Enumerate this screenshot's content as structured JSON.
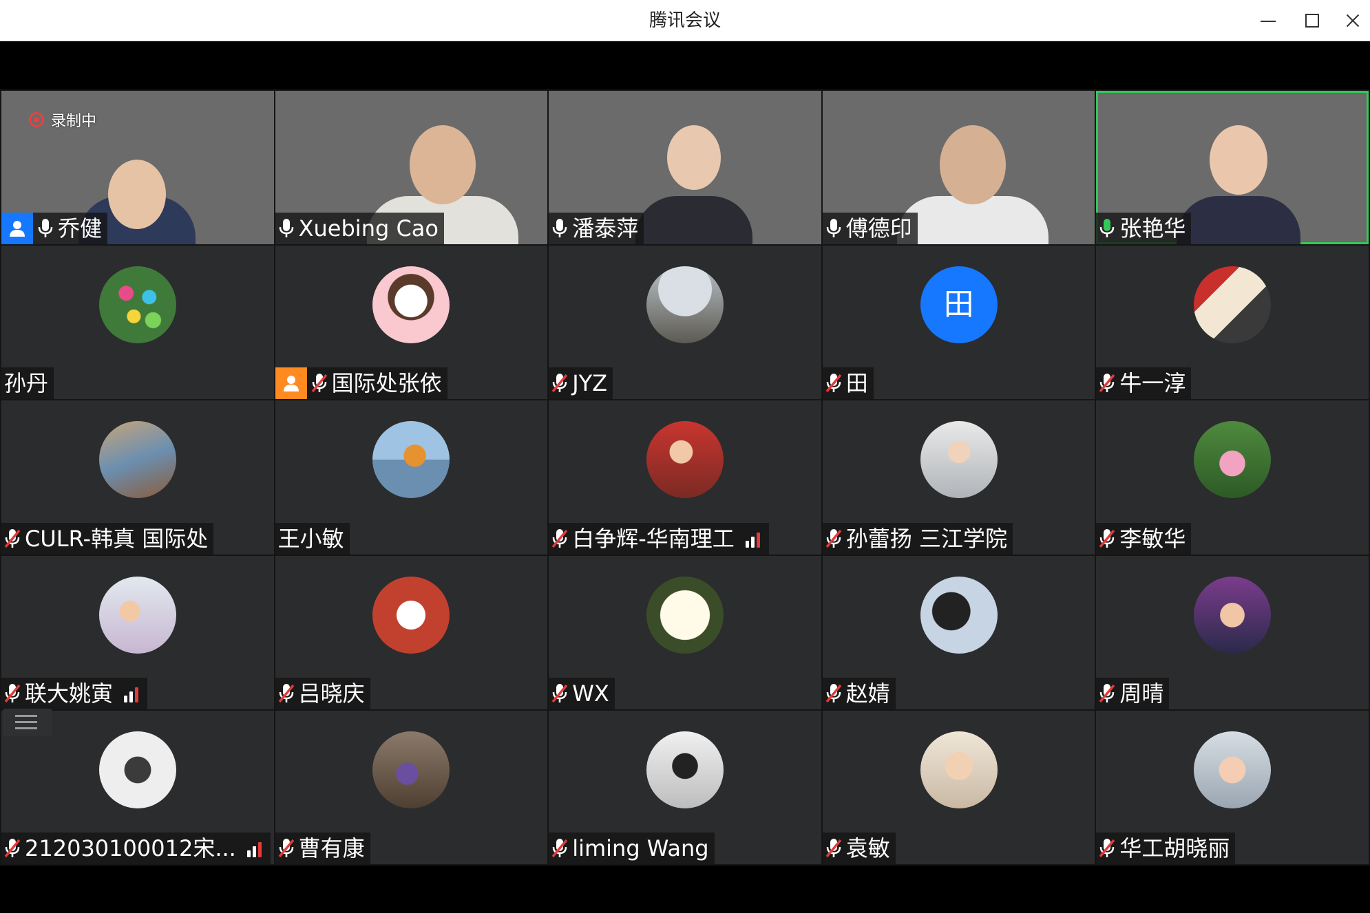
{
  "window": {
    "title": "腾讯会议",
    "controls": {
      "minimize_icon": "minimize-icon",
      "maximize_icon": "maximize-icon",
      "close_icon": "close-icon"
    }
  },
  "recording": {
    "label": "录制中",
    "color": "#e84141"
  },
  "colors": {
    "host_blue": "#1677ff",
    "host_orange": "#ff8a1f",
    "speaking_green": "#34c759",
    "tile_bg": "#2b2c2e"
  },
  "participants": [
    {
      "name": "乔健",
      "video": true,
      "mic": "on",
      "host_badge": "blue"
    },
    {
      "name": "Xuebing Cao",
      "video": true,
      "mic": "on"
    },
    {
      "name": "潘泰萍",
      "video": true,
      "mic": "on"
    },
    {
      "name": "傅德印",
      "video": true,
      "mic": "on"
    },
    {
      "name": "张艳华",
      "video": true,
      "mic": "speaking",
      "active": true
    },
    {
      "name": "孙丹",
      "mic": "none"
    },
    {
      "name": "国际处张依",
      "mic": "muted",
      "host_badge": "orange"
    },
    {
      "name": "JYZ",
      "mic": "muted"
    },
    {
      "name": "田",
      "mic": "muted",
      "avatar_letter": "田"
    },
    {
      "name": "牛一淳",
      "mic": "muted"
    },
    {
      "name": "CULR-韩真 国际处",
      "mic": "muted"
    },
    {
      "name": "王小敏",
      "mic": "none"
    },
    {
      "name": "白争辉-华南理工",
      "mic": "muted",
      "signal": true
    },
    {
      "name": "孙蕾扬 三江学院",
      "mic": "muted"
    },
    {
      "name": "李敏华",
      "mic": "muted"
    },
    {
      "name": "联大姚寅",
      "mic": "muted",
      "signal": true
    },
    {
      "name": "吕晓庆",
      "mic": "muted"
    },
    {
      "name": "WX",
      "mic": "muted"
    },
    {
      "name": "赵婧",
      "mic": "muted"
    },
    {
      "name": "周晴",
      "mic": "muted"
    },
    {
      "name": "212030100012宋...",
      "mic": "muted",
      "signal": true
    },
    {
      "name": "曹有康",
      "mic": "muted"
    },
    {
      "name": "liming Wang",
      "mic": "muted"
    },
    {
      "name": "袁敏",
      "mic": "muted"
    },
    {
      "name": "华工胡晓丽",
      "mic": "muted"
    }
  ]
}
